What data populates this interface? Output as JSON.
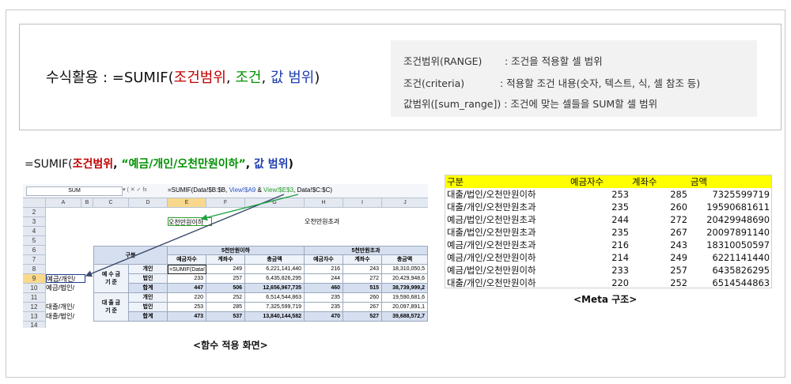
{
  "top": {
    "formula": {
      "prefix": "수식활용 : =SUMIF(",
      "arg1": "조건범위",
      "sep1": ",  ",
      "arg2": "조건",
      "sep2": ",  ",
      "arg3": "값 범위",
      "suffix": ")"
    },
    "definitions": [
      {
        "term": "조건범위(RANGE)",
        "desc": ": 조건을 적용할 셀 범위"
      },
      {
        "term": "조건(criteria)",
        "desc": ": 적용할 조건 내용(숫자, 텍스트, 식, 셀 참조 등)"
      },
      {
        "term": "값범위([sum_range])",
        "desc": ": 조건에 맞는 셀들을 SUM할 셀 범위"
      }
    ]
  },
  "formula2": {
    "prefix": "=SUMIF(",
    "arg1": "조건범위",
    "sep1": ",  ",
    "arg2": "“예금/개인/오천만원이하”",
    "sep2": ",  ",
    "arg3": "값 범위",
    "suffix": ")"
  },
  "excel": {
    "name_box": "SUM",
    "fx_icons": "▾ ( ✕ ✓ fx",
    "formula_parts": [
      "=SUMIF(Data!$B:$B,  ",
      "View!$A9",
      " & ",
      "View!$E$3",
      ",   Data!$C:$C)"
    ],
    "columns": [
      "A",
      "B",
      "C",
      "D",
      "E",
      "F",
      "G",
      "H",
      "I",
      "J"
    ],
    "rows": [
      "2",
      "3",
      "4",
      "5",
      "6",
      "7",
      "8",
      "9",
      "10",
      "11",
      "12",
      "13",
      "14"
    ],
    "e3": "오천만원이하",
    "h3": "오천만원초과",
    "a9": "예금/개인/",
    "a10": "예금/법인/",
    "a12": "대출/개인/",
    "a13": "대출/법인/",
    "group_header": "구분",
    "band1": "5천만원이하",
    "band2": "5천만원초과",
    "subheaders": [
      "예금자수",
      "계좌수",
      "총금액",
      "예금자수",
      "계좌수",
      "총금액"
    ],
    "sections": [
      {
        "label": "예 수 금\n기 준",
        "rows": [
          {
            "kind": "개인",
            "vals": [
              "=SUMIF(Data!",
              "249",
              "6,221,141,440",
              "216",
              "243",
              "18,310,050,5"
            ]
          },
          {
            "kind": "법인",
            "vals": [
              "233",
              "257",
              "6,435,826,295",
              "244",
              "272",
              "20,429,948,6"
            ]
          },
          {
            "kind": "합계",
            "vals": [
              "447",
              "506",
              "12,656,967,735",
              "460",
              "515",
              "38,739,999,2"
            ]
          }
        ]
      },
      {
        "label": "대 출 금\n기 준",
        "rows": [
          {
            "kind": "개인",
            "vals": [
              "220",
              "252",
              "6,514,544,863",
              "235",
              "260",
              "19,590,681,6"
            ]
          },
          {
            "kind": "법인",
            "vals": [
              "253",
              "285",
              "7,325,599,719",
              "235",
              "267",
              "20,097,891,1"
            ]
          },
          {
            "kind": "합계",
            "vals": [
              "473",
              "537",
              "13,840,144,582",
              "470",
              "527",
              "39,688,572,7"
            ]
          }
        ]
      }
    ],
    "colors": {
      "header": "#d6dff0",
      "arrow_dark": "#3a4a6a",
      "arrow_green": "#1fa040"
    }
  },
  "caption_excel": "<함수 적용 화면>",
  "meta": {
    "headers": [
      "구분",
      "예금자수",
      "계좌수",
      "금액"
    ],
    "rows": [
      [
        "대출/법인/오천만원이하",
        "253",
        "285",
        "7325599719"
      ],
      [
        "대출/개인/오천만원초과",
        "235",
        "260",
        "19590681611"
      ],
      [
        "예금/법인/오천만원초과",
        "244",
        "272",
        "20429948690"
      ],
      [
        "대출/법인/오천만원초과",
        "235",
        "267",
        "20097891140"
      ],
      [
        "예금/개인/오천만원초과",
        "216",
        "243",
        "18310050597"
      ],
      [
        "예금/개인/오천만원이하",
        "214",
        "249",
        "6221141440"
      ],
      [
        "예금/법인/오천만원이하",
        "233",
        "257",
        "6435826295"
      ],
      [
        "대출/개인/오천만원이하",
        "220",
        "252",
        "6514544863"
      ]
    ],
    "highlight_color": "#ffff00"
  },
  "caption_meta": "<Meta 구조>"
}
